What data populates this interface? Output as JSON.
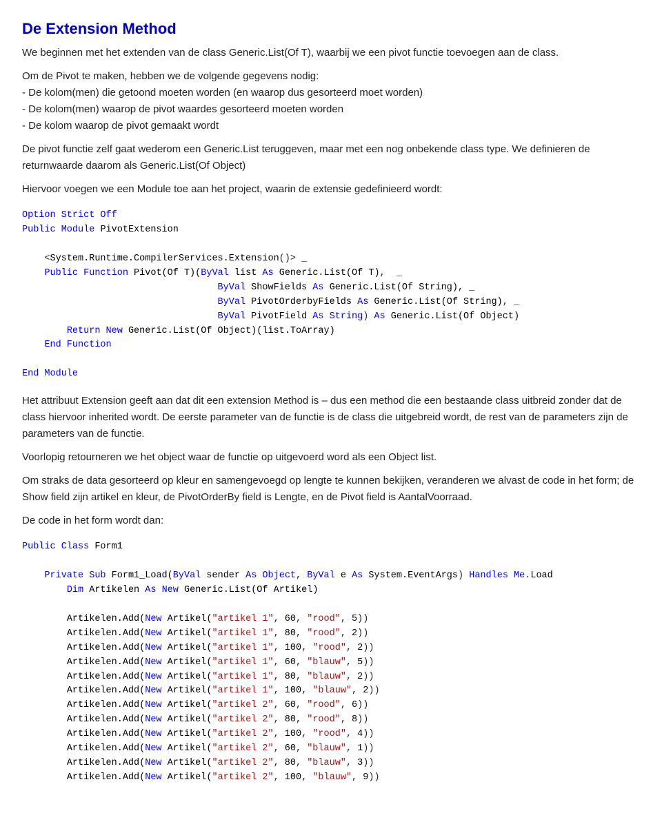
{
  "title": "De Extension Method",
  "paragraphs": {
    "p1": "We beginnen met het extenden van de class Generic.List(Of T), waarbij we een pivot functie toevoegen aan de class.",
    "p2": "Om de Pivot te maken, hebben we de volgende gegevens nodig:\n- De kolom(men) die getoond moeten worden (en waarop dus gesorteerd moet worden)\n- De kolom(men) waarop de pivot waardes gesorteerd moeten worden\n- De kolom waarop de pivot gemaakt wordt",
    "p3": "De pivot functie zelf gaat wederom een Generic.List teruggeven, maar met een nog onbekende class type. We definieren de returnwaarde daarom als Generic.List(Of Object)",
    "p4": "Hiervoor voegen we een Module toe aan het project, waarin de extensie gedefinieerd wordt:",
    "p5": "Het attribuut Extension geeft aan dat dit een extension Method is – dus een method die een bestaande class uitbreid zonder dat de class hiervoor inherited wordt. De eerste parameter van de functie is de class die uitgebreid wordt, de rest van de parameters zijn de parameters van de functie.",
    "p6": "Voorlopig retourneren we het object waar de functie op uitgevoerd word als een Object list.",
    "p7": "Om straks de data gesorteerd op kleur en samengevoegd op lengte te kunnen bekijken, veranderen we alvast de code in het form; de Show field zijn artikel en kleur, de PivotOrderBy field is Lengte, en de Pivot field is AantalVoorraad.",
    "p8": "De code in het form wordt dan:"
  }
}
